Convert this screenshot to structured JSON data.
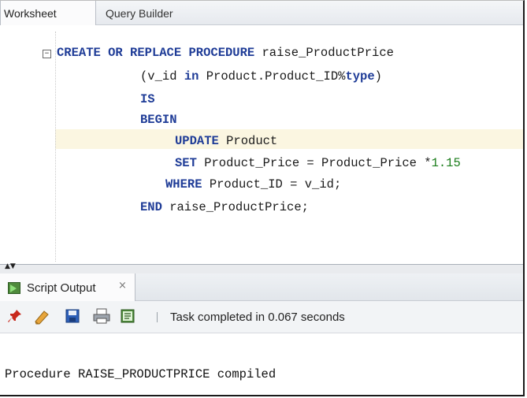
{
  "editor_tabs": {
    "worksheet": "Worksheet",
    "query_builder": "Query Builder"
  },
  "code": {
    "line1": {
      "kw1": "CREATE",
      "sp1": " ",
      "kw2": "OR",
      "sp2": " ",
      "kw3": "REPLACE",
      "sp3": " ",
      "kw4": "PROCEDURE",
      "rest": " raise_ProductPrice"
    },
    "line2": {
      "pre": "(v_id ",
      "kw": "in",
      "mid": " Product.Product_ID%",
      "kw2": "type",
      "post": ")"
    },
    "line3": {
      "kw": "IS"
    },
    "line4": {
      "kw": "BEGIN"
    },
    "line5": {
      "kw": "UPDATE",
      "rest": " Product"
    },
    "line6": {
      "kw": "SET",
      "rest": " Product_Price = Product_Price *",
      "num": "1.15"
    },
    "line7": {
      "kw": "WHERE",
      "rest": " Product_ID = v_id;"
    },
    "line8": {
      "kw": "END",
      "rest": " raise_ProductPrice;"
    }
  },
  "output_panel": {
    "tab_label": "Script Output",
    "close": "×",
    "status": "Task completed in 0.067 seconds",
    "message": "Procedure RAISE_PRODUCTPRICE compiled"
  },
  "icons": [
    "fold-minus-icon",
    "pin-icon",
    "eraser-icon",
    "save-icon",
    "print-icon",
    "export-icon",
    "script-icon"
  ],
  "colors": {
    "keyword": "#1f3c97",
    "number": "#1b7d1b",
    "current_line": "#fbf6e1"
  }
}
